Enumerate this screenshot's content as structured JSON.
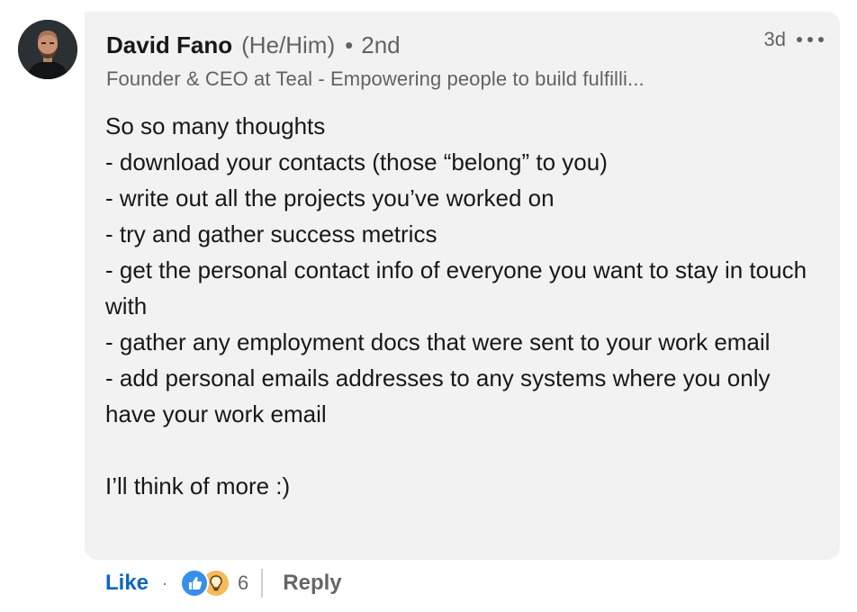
{
  "author": {
    "name": "David Fano",
    "pronouns": "(He/Him)",
    "separator": "•",
    "degree": "2nd",
    "headline": "Founder & CEO at Teal - Empowering people to build fulfilli..."
  },
  "comment": {
    "timestamp": "3d",
    "more_icon": "ellipsis-icon",
    "text": "So so many thoughts\n- download your contacts (those “belong” to you)\n- write out all the projects you’ve worked on\n- try and gather success metrics\n- get the personal contact info of everyone you want to stay in touch with\n- gather any employment docs that were sent to your work email\n- add personal emails addresses to any systems where you only have your work email\n\nI’ll think of more :)"
  },
  "actions": {
    "like_label": "Like",
    "separator": "·",
    "reaction_icons": [
      "like-icon",
      "insightful-icon"
    ],
    "reaction_count": "6",
    "reply_label": "Reply"
  },
  "colors": {
    "bubble": "#f2f2f2",
    "like_blue": "#0a66c2",
    "muted_text": "#666666"
  }
}
